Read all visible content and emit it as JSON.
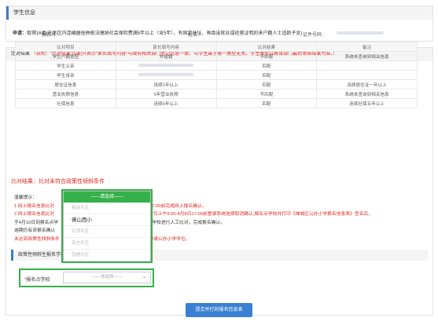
{
  "student_info": {
    "title": "学生信息",
    "number_label": "报名号:",
    "name_label": "姓名:",
    "id_label": "证件号码:"
  },
  "compare": {
    "title": "比对结果",
    "notice": "（说明：\"比对结果\"匹配只表示\"家长填写内容\"与政府相关部门登记信息一致，与学生属于哪一类型无关。学生类型以教育部门最后审核结果为准。）",
    "apply_label": "申请：",
    "apply_text": "取得16类(在本区内连续居住并依法缴纳社会保险费满5年以上（含5年），有固定住址、有合法就业或经营证明的来户籍人士适龄子女)",
    "columns": [
      "比对项目",
      "家长填写内容",
      "比对结果",
      "备注"
    ],
    "rows": [
      {
        "item": "学生户籍类型",
        "value": "外省籍",
        "result": "不匹配",
        "status": "bad",
        "note": "系统未查询到相关信息"
      },
      {
        "item": "学生父亲",
        "value": "",
        "result": "匹配",
        "status": "ok",
        "note": ""
      },
      {
        "item": "学生母亲",
        "value": "",
        "result": "匹配",
        "status": "ok",
        "note": ""
      },
      {
        "item": "居住证信息",
        "value": "连续1年以上",
        "result": "匹配",
        "status": "ok",
        "note": "连续居住证一年以上"
      },
      {
        "item": "营业执照信息",
        "value": "5年营业执照",
        "result": "不匹配",
        "status": "bad",
        "note": "系统未查询到相关信息"
      },
      {
        "item": "社保信息",
        "value": "连续5年以上",
        "result": "匹配",
        "status": "ok",
        "note": "连续社保五年以上"
      }
    ],
    "result_text": "比对结果：比对未符合政策性倾斜条件"
  },
  "tips": {
    "title": "温馨提示：",
    "line1_a": "1.网上报名信息比对",
    "line1_b": "0-4月9日 17:00前完成网上报名确认。",
    "line2_a": "2.网上报名信息比对",
    "line2_b": "家长在4月7日上午9:00-4月8日17:00前登录系统选择取消确认,报名点学校并打印《禅城区公办小学报名信息表》签名后，",
    "line3_a": "于4月10日到报名点学",
    "line3_b": "由报名点学校进行人工比对，完成报名确认。",
    "line4_a": "逾期仍有资报名确认",
    "line5_a": "未达到政策性倾斜条件",
    "line5_b": "一糊地申请公办小学学位。"
  },
  "policy": {
    "title": "政策性倾斜生报名学校",
    "school_label": "报名点学校:",
    "select_placeholder": "——请选择——"
  },
  "dropdown": {
    "header": "——请选择——",
    "items": [
      "祖庙片区",
      "佛山西小",
      "石湾片区",
      "南庄片区",
      "张槎片区"
    ],
    "active_index": 1
  },
  "submit_label": "提交并打印报名信息表",
  "colors": {
    "accent_blue": "#3a80d2",
    "highlight_green": "#36b04a",
    "error_red": "#e0261f",
    "match_green": "#1f9a3c"
  }
}
